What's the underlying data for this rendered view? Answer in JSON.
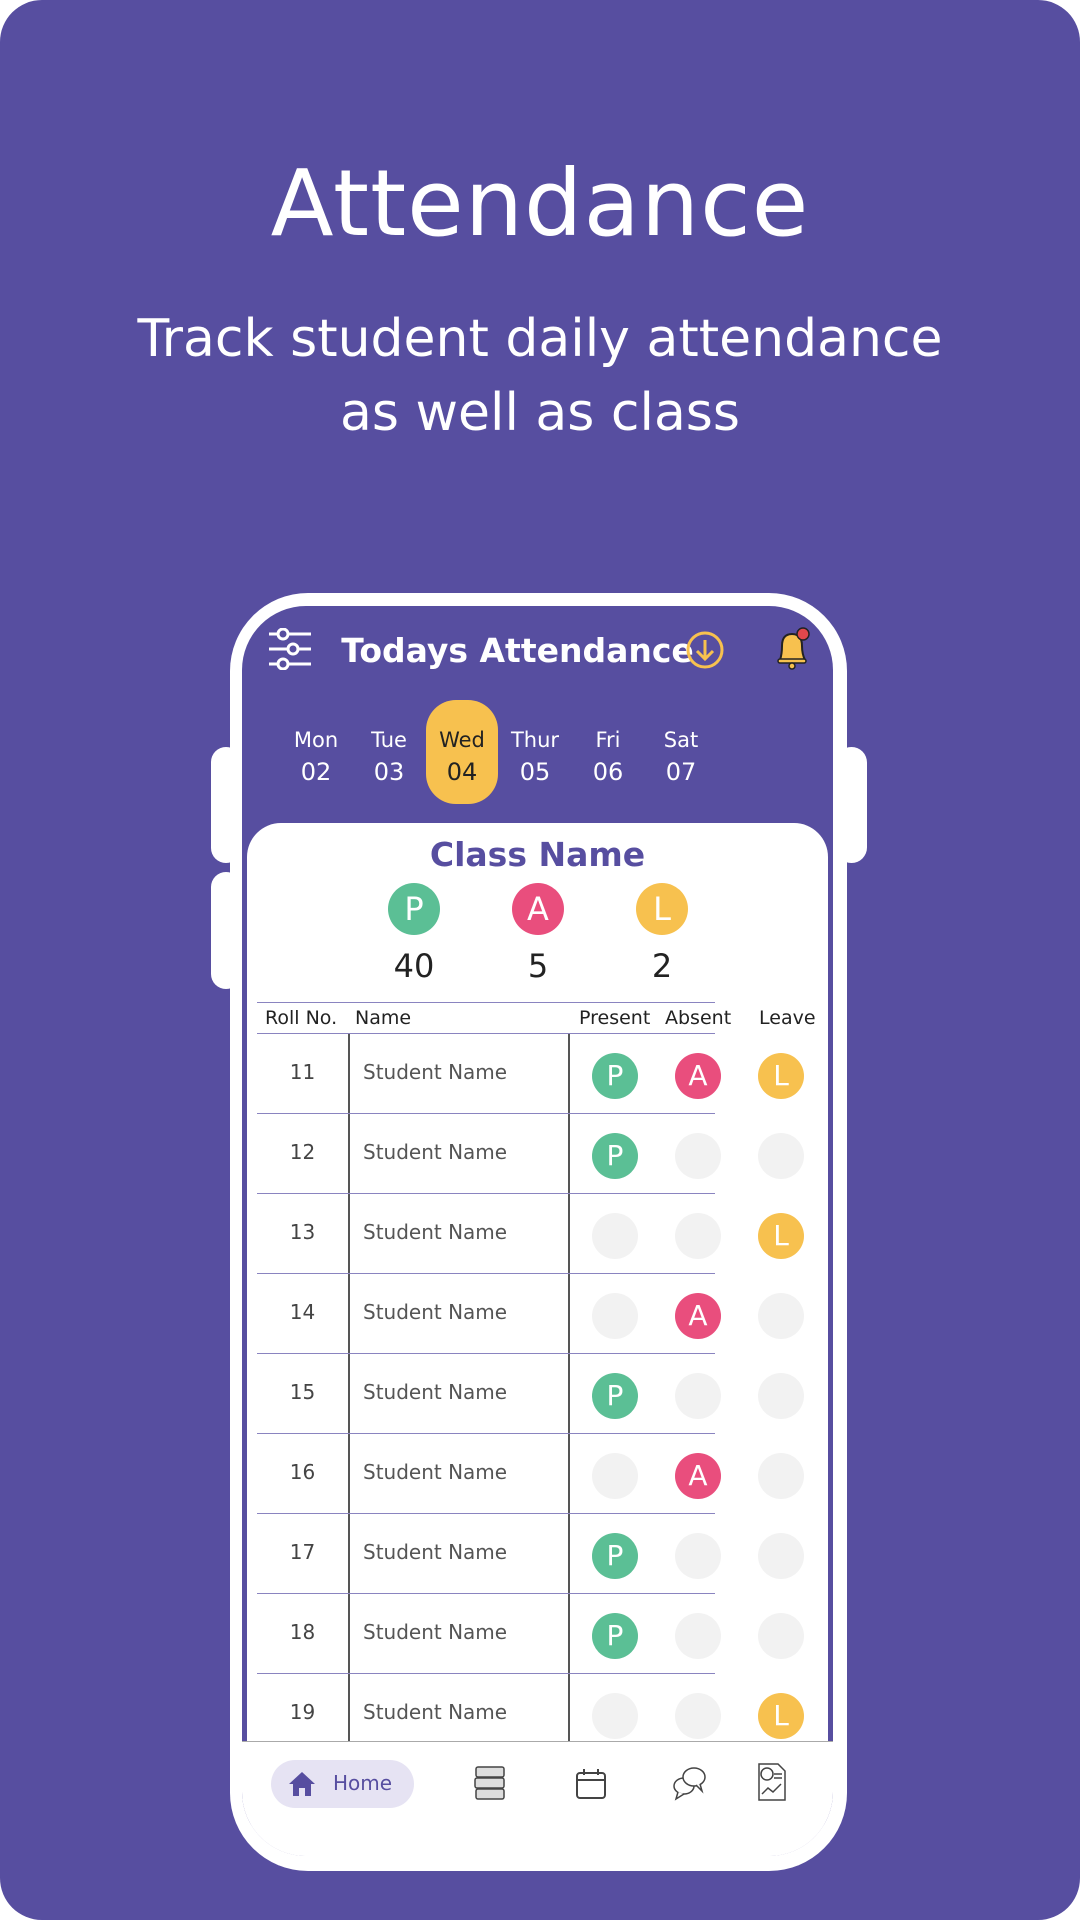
{
  "hero": {
    "title": "Attendance",
    "subtitle_line1": "Track student daily attendance",
    "subtitle_line2": "as well as class"
  },
  "app": {
    "header": {
      "title": "Todays Attendance",
      "icons": [
        "sliders-icon",
        "download-circle-icon",
        "bell-notification-icon"
      ]
    },
    "days": [
      {
        "name": "Mon",
        "date": "02"
      },
      {
        "name": "Tue",
        "date": "03"
      },
      {
        "name": "Wed",
        "date": "04",
        "selected": true
      },
      {
        "name": "Thur",
        "date": "05"
      },
      {
        "name": "Fri",
        "date": "06"
      },
      {
        "name": "Sat",
        "date": "07"
      }
    ],
    "class_name": "Class Name",
    "summary": {
      "present": {
        "letter": "P",
        "count": "40"
      },
      "absent": {
        "letter": "A",
        "count": "5"
      },
      "leave": {
        "letter": "L",
        "count": "2"
      }
    },
    "colors": {
      "present": "#5bbf95",
      "absent": "#e94e7d",
      "leave": "#f7c14f",
      "accent": "#574ea0"
    },
    "table": {
      "headers": {
        "roll": "Roll No.",
        "name": "Name",
        "present": "Present",
        "absent": "Absent",
        "leave": "Leave"
      },
      "rows": [
        {
          "roll": "11",
          "name": "Student Name",
          "present": true,
          "absent": true,
          "leave": true
        },
        {
          "roll": "12",
          "name": "Student Name",
          "present": true,
          "absent": false,
          "leave": false
        },
        {
          "roll": "13",
          "name": "Student Name",
          "present": false,
          "absent": false,
          "leave": true
        },
        {
          "roll": "14",
          "name": "Student Name",
          "present": false,
          "absent": true,
          "leave": false
        },
        {
          "roll": "15",
          "name": "Student Name",
          "present": true,
          "absent": false,
          "leave": false
        },
        {
          "roll": "16",
          "name": "Student Name",
          "present": false,
          "absent": true,
          "leave": false
        },
        {
          "roll": "17",
          "name": "Student Name",
          "present": true,
          "absent": false,
          "leave": false
        },
        {
          "roll": "18",
          "name": "Student Name",
          "present": true,
          "absent": false,
          "leave": false
        },
        {
          "roll": "19",
          "name": "Student Name",
          "present": false,
          "absent": false,
          "leave": true
        }
      ]
    },
    "nav": {
      "home_label": "Home",
      "icons": [
        "home-icon",
        "books-icon",
        "calendar-icon",
        "chat-icon",
        "report-icon"
      ]
    }
  }
}
